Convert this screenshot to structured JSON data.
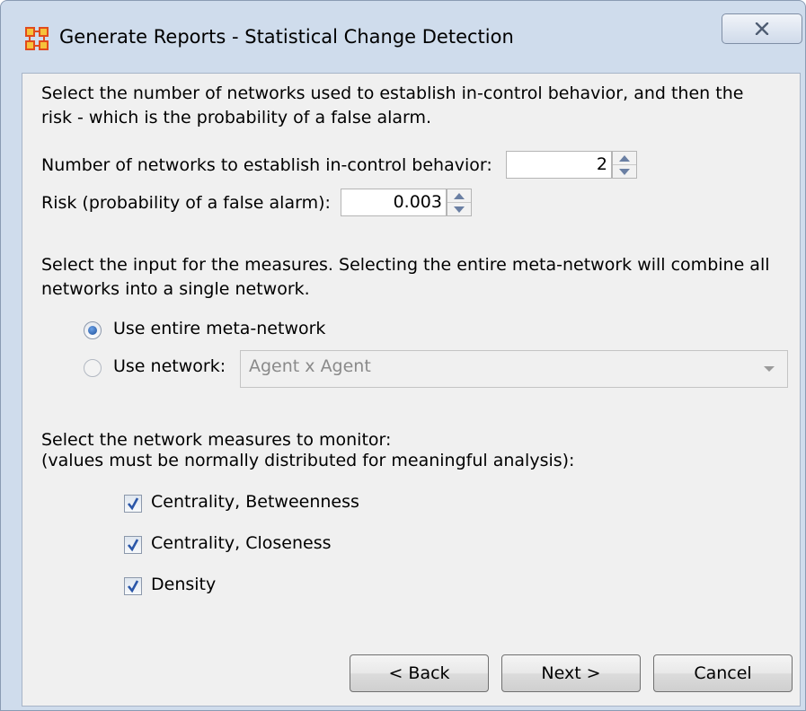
{
  "window": {
    "title": "Generate Reports - Statistical Change Detection"
  },
  "intro": {
    "text_line1": "Select the number of networks used to establish in-control behavior, and then the",
    "text_line2": "risk - which is the probability of a false alarm."
  },
  "networks_field": {
    "label": "Number of networks to establish in-control behavior:",
    "value": "2"
  },
  "risk_field": {
    "label": "Risk (probability of a false alarm):",
    "value": "0.003"
  },
  "input_section": {
    "text_line1": "Select the input for the measures. Selecting the entire meta-network will combine all",
    "text_line2": "networks into a single network.",
    "option_entire": "Use entire meta-network",
    "option_network": "Use network:",
    "selected_option": "entire",
    "network_select_value": "Agent x Agent"
  },
  "measures_section": {
    "text_line1": "Select the network measures to monitor:",
    "text_line2": "(values must be normally distributed for meaningful analysis):",
    "measures": [
      {
        "label": "Centrality, Betweenness",
        "checked": true
      },
      {
        "label": "Centrality, Closeness",
        "checked": true
      },
      {
        "label": "Density",
        "checked": true
      }
    ]
  },
  "buttons": {
    "back": "< Back",
    "next": "Next >",
    "cancel": "Cancel"
  },
  "colors": {
    "frame": "#cfdcec",
    "client": "#f0f0f0",
    "spinner_arrow": "#6a7fa3",
    "check_mark": "#2a56a8",
    "app_icon": "#e14b1c"
  },
  "icons": {
    "app": "app-network-icon",
    "close": "close-icon"
  }
}
